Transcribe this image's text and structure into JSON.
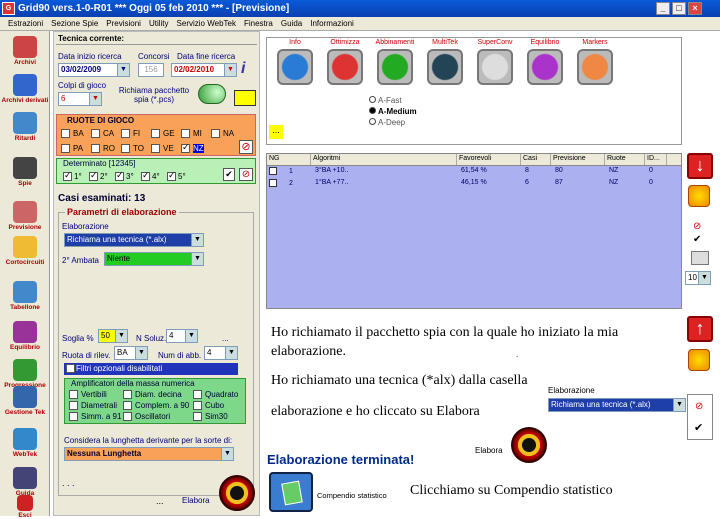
{
  "window": {
    "title": "Grid90 vers.1-0-R01  ***  Oggi 05 feb 2010  ***  - [Previsione]",
    "min": "_",
    "max": "□",
    "close": "×",
    "app_icon": "G"
  },
  "menu": [
    "Estrazioni",
    "Sezione Spie",
    "Previsioni",
    "Utility",
    "Servizio WebTek",
    "Finestra",
    "Guida",
    "Informazioni"
  ],
  "sidebar": [
    {
      "label": "Archivi",
      "icon": "pencil-icon",
      "color": "#c44"
    },
    {
      "label": "Archivi derivati",
      "icon": "folder-icon",
      "color": "#36c"
    },
    {
      "label": "Ritardi",
      "icon": "clock-icon",
      "color": "#48c"
    },
    {
      "label": "Spie",
      "icon": "spy-icon",
      "color": "#444"
    },
    {
      "label": "Previsione",
      "icon": "notepad-icon",
      "color": "#c66"
    },
    {
      "label": "Cortocircuiti",
      "icon": "bulb-icon",
      "color": "#eb3"
    },
    {
      "label": "Tabellone",
      "icon": "calendar-icon",
      "color": "#48c"
    },
    {
      "label": "Equilibrio",
      "icon": "scale-icon",
      "color": "#939"
    },
    {
      "label": "Progressione",
      "icon": "dollar-icon",
      "color": "#393"
    },
    {
      "label": "Gestione Tek",
      "icon": "tools-icon",
      "color": "#36a"
    },
    {
      "label": "WebTek",
      "icon": "globe-icon",
      "color": "#38c"
    },
    {
      "label": "Guida",
      "icon": "book-icon",
      "color": "#447"
    },
    {
      "label": "Esci",
      "icon": "exit-icon",
      "color": "#c22"
    }
  ],
  "left": {
    "header": "Tecnica corrente:",
    "data_inizio_label": "Data inizio ricerca",
    "data_inizio": "03/02/2009",
    "concorsi_label": "Concorsi",
    "concorsi": "156",
    "data_fine_label": "Data fine ricerca",
    "data_fine": "02/02/2010",
    "colpi_label": "Colpi di gioco",
    "colpi": "6",
    "richiama_label": "Richiama pacchetto spia (*.pcs)",
    "ruote_title": "RUOTE DI GIOCO",
    "ruote_row1": [
      "BA",
      "CA",
      "FI",
      "GE",
      "MI",
      "NA"
    ],
    "ruote_row2": [
      "PA",
      "RO",
      "TO",
      "VE",
      "NZ"
    ],
    "ruote_checked": [
      "NZ"
    ],
    "determinato_label": "Determinato [12345]",
    "determinato": [
      "1°",
      "2°",
      "3°",
      "4°",
      "5°"
    ],
    "casi": "Casi esaminati: 13",
    "param_title": "Parametri di elaborazione",
    "elab_label": "Elaborazione",
    "elab_value": "Richiama una tecnica (*.alx)",
    "ambata_label": "2° Ambata",
    "ambata_value": "Niente",
    "soglia_label": "Soglia %",
    "soglia": "50",
    "nsoluz_label": "N Soluz.",
    "nsoluz": "4",
    "ruota_ril_label": "Ruota di rilev.",
    "ruota_ril": "BA",
    "numabb_label": "Num di abb.",
    "numabb": "4",
    "filtri": "Filtri opzionali disabilitati",
    "ampl_title": "Amplificatori della massa numerica",
    "ampl": [
      "Vertibili",
      "Diam. decina",
      "Quadrato",
      "Diametrali",
      "Complem. a 90",
      "Cubo",
      "Simm. a 91",
      "Oscillatori",
      "Sim30"
    ],
    "lunghezza_label": "Considera la lunghetta derivante per la sorte di:",
    "lunghezza": "Nessuna Lunghetta",
    "dots1": ". . .",
    "dots2": "...",
    "elabora": "Elabora",
    "ellipsis_small": "..."
  },
  "tools": [
    {
      "label": "Info",
      "icon": "question-icon",
      "color": "#2a7bd4"
    },
    {
      "label": "Ottimizza",
      "icon": "flame-icon",
      "color": "#d33"
    },
    {
      "label": "Abbinamenti",
      "icon": "gear-icon",
      "color": "#2a2"
    },
    {
      "label": "MultiTek",
      "icon": "swirl-icon",
      "color": "#245"
    },
    {
      "label": "SuperConv",
      "icon": "recycle-icon",
      "color": "#ddd"
    },
    {
      "label": "Equilibrio",
      "icon": "cube-icon",
      "color": "#a3c"
    },
    {
      "label": "Markers",
      "icon": "ball-icon",
      "color": "#e84"
    }
  ],
  "modes": [
    {
      "label": "A-Fast",
      "on": false
    },
    {
      "label": "A-Medium",
      "on": true
    },
    {
      "label": "A-Deep",
      "on": false
    }
  ],
  "grid": {
    "headers": [
      "NG",
      "Algoritmi",
      "Favorevoli",
      "Casi",
      "Previsione",
      "Ruote",
      "ID..."
    ],
    "rows": [
      {
        "ng": "1",
        "alg": "3°BA +10..",
        "fav": "61,54 %",
        "casi": "8",
        "prev": "80",
        "ruote": "NZ",
        "id": "0"
      },
      {
        "ng": "2",
        "alg": "1°BA +77..",
        "fav": "46,15 %",
        "casi": "6",
        "prev": "87",
        "ruote": "NZ",
        "id": "0"
      }
    ]
  },
  "notes": {
    "n1": "Ho richiamato il pacchetto  spia con la quale ho iniziato la mia elaborazione.",
    "n2": "Ho richiamato una tecnica (*alx) dalla casella",
    "n3": "elaborazione e ho cliccato su Elabora",
    "n4": "Clicchiamo su Compendio statistico",
    "dot": "."
  },
  "right": {
    "elab_label": "Elaborazione",
    "elab_value": "Richiama una tecnica (*.alx)",
    "elabora": "Elabora",
    "terminata": "Elaborazione terminata!",
    "compendio": "Compendio statistico",
    "ten": "10",
    "down_arrow": "↓",
    "up_arrow": "↑",
    "check": "✔",
    "no": "⊘",
    "dd": "▼"
  }
}
